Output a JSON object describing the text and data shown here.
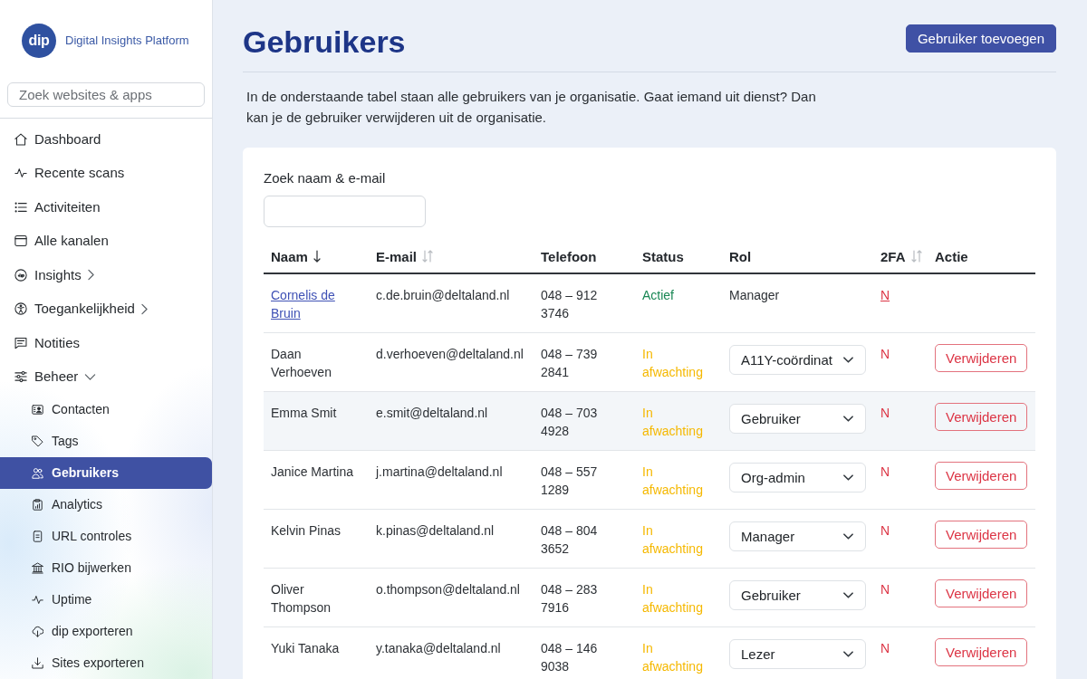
{
  "sidebar": {
    "logo": {
      "mark": "dip",
      "name": "Digital Insights Platform"
    },
    "search": {
      "placeholder": "Zoek websites & apps"
    },
    "items": [
      {
        "label": "Dashboard",
        "selected": false
      },
      {
        "label": "Recente scans",
        "selected": false
      },
      {
        "label": "Activiteiten",
        "selected": false
      },
      {
        "label": "Alle kanalen",
        "selected": false
      },
      {
        "label": "Insights",
        "selected": false,
        "expanded": false
      },
      {
        "label": "Toegankelijkheid",
        "selected": false,
        "expanded": false
      },
      {
        "label": "Notities",
        "selected": false
      },
      {
        "label": "Beheer",
        "selected": false,
        "expanded": true,
        "children": [
          {
            "label": "Contacten",
            "selected": false
          },
          {
            "label": "Tags",
            "selected": false
          },
          {
            "label": "Gebruikers",
            "selected": true
          },
          {
            "label": "Analytics",
            "selected": false
          },
          {
            "label": "URL controles",
            "selected": false
          },
          {
            "label": "RIO bijwerken",
            "selected": false
          },
          {
            "label": "Uptime",
            "selected": false
          },
          {
            "label": "dip exporteren",
            "selected": false
          },
          {
            "label": "Sites exporteren",
            "selected": false
          }
        ]
      }
    ]
  },
  "header": {
    "title": "Gebruikers",
    "add_button": "Gebruiker toevoegen"
  },
  "intro": "In de onderstaande tabel staan alle gebruikers van je organisatie. Gaat iemand uit dienst? Dan kan je de gebruiker verwijderen uit de organisatie.",
  "users_card": {
    "search": {
      "label": "Zoek naam & e-mail"
    },
    "columns": [
      {
        "label": "Naam",
        "sortable": true,
        "sorted": true
      },
      {
        "label": "E-mail",
        "sortable": true,
        "sorted": false
      },
      {
        "label": "Telefoon",
        "sortable": false
      },
      {
        "label": "Status",
        "sortable": false
      },
      {
        "label": "Rol",
        "sortable": false
      },
      {
        "label": "2FA",
        "sortable": true,
        "sorted": false
      },
      {
        "label": "Actie",
        "sortable": false
      }
    ],
    "rows": [
      {
        "name": "Cornelis de Bruin",
        "name_link": true,
        "email": "c.de.bruin@deltaland.nl",
        "phone": "048 – 912 3746",
        "status": "Actief",
        "status_active": true,
        "role": "Manager",
        "role_editable": false,
        "two_factor": "N",
        "two_factor_link": true,
        "hovered": false
      },
      {
        "name": "Daan Verhoeven",
        "name_link": false,
        "email": "d.verhoeven@deltaland.nl",
        "phone": "048 – 739 2841",
        "status": "In afwachting",
        "status_active": false,
        "role": "A11Y-coördinat",
        "role_editable": true,
        "two_factor": "N",
        "two_factor_link": false,
        "action": "Verwijderen",
        "hovered": false
      },
      {
        "name": "Emma Smit",
        "name_link": false,
        "email": "e.smit@deltaland.nl",
        "phone": "048 – 703 4928",
        "status": "In afwachting",
        "status_active": false,
        "role": "Gebruiker",
        "role_editable": true,
        "two_factor": "N",
        "two_factor_link": false,
        "action": "Verwijderen",
        "hovered": true
      },
      {
        "name": "Janice Martina",
        "name_link": false,
        "email": "j.martina@deltaland.nl",
        "phone": "048 – 557 1289",
        "status": "In afwachting",
        "status_active": false,
        "role": "Org-admin",
        "role_editable": true,
        "two_factor": "N",
        "two_factor_link": false,
        "action": "Verwijderen",
        "hovered": false
      },
      {
        "name": "Kelvin Pinas",
        "name_link": false,
        "email": "k.pinas@deltaland.nl",
        "phone": "048 – 804 3652",
        "status": "In afwachting",
        "status_active": false,
        "role": "Manager",
        "role_editable": true,
        "two_factor": "N",
        "two_factor_link": false,
        "action": "Verwijderen",
        "hovered": false
      },
      {
        "name": "Oliver Thompson",
        "name_link": false,
        "email": "o.thompson@deltaland.nl",
        "phone": "048 – 283 7916",
        "status": "In afwachting",
        "status_active": false,
        "role": "Gebruiker",
        "role_editable": true,
        "two_factor": "N",
        "two_factor_link": false,
        "action": "Verwijderen",
        "hovered": false
      },
      {
        "name": "Yuki Tanaka",
        "name_link": false,
        "email": "y.tanaka@deltaland.nl",
        "phone": "048 – 146 9038",
        "status": "In afwachting",
        "status_active": false,
        "role": "Lezer",
        "role_editable": true,
        "two_factor": "N",
        "two_factor_link": false,
        "action": "Verwijderen",
        "hovered": false
      }
    ]
  }
}
